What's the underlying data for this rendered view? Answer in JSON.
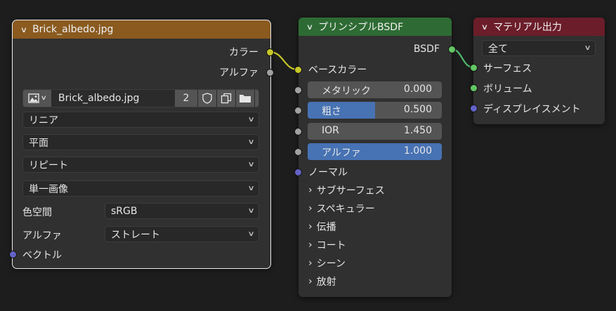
{
  "image_node": {
    "title": "Brick_albedo.jpg",
    "outputs": [
      "カラー",
      "アルファ"
    ],
    "image_name": "Brick_albedo.jpg",
    "users": "2",
    "interpolation": "リニア",
    "projection": "平面",
    "extension": "リピート",
    "source": "単一画像",
    "colorspace_label": "色空間",
    "colorspace": "sRGB",
    "alpha_label": "アルファ",
    "alpha_mode": "ストレート",
    "vector_label": "ベクトル",
    "header_color": "#8a5a1f"
  },
  "bsdf_node": {
    "title": "プリンシプルBSDF",
    "output": "BSDF",
    "base_color": "ベースカラー",
    "metallic_label": "メタリック",
    "metallic_value": "0.000",
    "roughness_label": "粗さ",
    "roughness_value": "0.500",
    "roughness_fraction": 0.5,
    "ior_label": "IOR",
    "ior_value": "1.450",
    "alpha_label": "アルファ",
    "alpha_value": "1.000",
    "alpha_fraction": 1.0,
    "normal": "ノーマル",
    "panels": [
      "サブサーフェス",
      "スペキュラー",
      "伝播",
      "コート",
      "シーン",
      "放射"
    ],
    "header_color": "#2e6b34"
  },
  "output_node": {
    "title": "マテリアル出力",
    "target": "全て",
    "inputs": [
      "サーフェス",
      "ボリューム",
      "ディスプレイスメント"
    ],
    "header_color": "#6b1d29"
  },
  "colors": {
    "socket_color": "#c7c729",
    "socket_float": "#a1a1a1",
    "socket_vector": "#6363c7",
    "socket_shader": "#63c763",
    "accent": "#4772b3"
  }
}
